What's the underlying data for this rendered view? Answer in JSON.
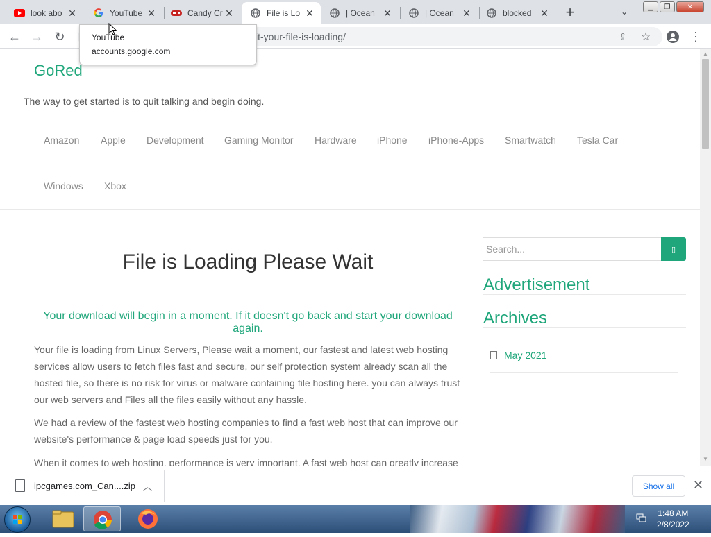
{
  "browser": {
    "tabs": [
      {
        "title": "look abo",
        "icon": "youtube-icon"
      },
      {
        "title": "YouTube",
        "icon": "google-icon"
      },
      {
        "title": "Candy Cr",
        "icon": "gamepad-icon"
      },
      {
        "title": "File is Lo",
        "icon": "globe-icon",
        "active": true
      },
      {
        "title": "| Ocean",
        "icon": "globe-icon"
      },
      {
        "title": "| Ocean",
        "icon": "globe-icon"
      },
      {
        "title": "blocked",
        "icon": "globe-icon"
      }
    ],
    "url": "it-your-file-is-loading/",
    "tooltip": {
      "title": "YouTube",
      "url": "accounts.google.com"
    }
  },
  "site": {
    "title": "GoRed",
    "tagline": "The way to get started is to quit talking and begin doing.",
    "nav": [
      "Amazon",
      "Apple",
      "Development",
      "Gaming Monitor",
      "Hardware",
      "iPhone",
      "iPhone-Apps",
      "Smartwatch",
      "Tesla Car",
      "Windows",
      "Xbox"
    ]
  },
  "post": {
    "title": "File is Loading Please Wait",
    "notice_line1": "Your download will begin in a moment. If it doesn't go back and start your download",
    "notice_line2": "again.",
    "paragraphs": [
      "Your file is loading from Linux Servers, Please wait a moment, our fastest and latest web hosting services allow users to fetch files fast and secure, our self protection system already scan all the hosted file, so there is no risk for virus or malware containing file hosting here. you can always trust our web servers and Files all the files easily without any hassle.",
      "We had a review of the fastest web hosting companies to find a fast web host that can improve our website's performance & page load speeds just for you.",
      "When it comes to web hosting, performance is very important. A fast web host can greatly increase"
    ]
  },
  "sidebar": {
    "search_placeholder": "Search...",
    "advertisement_title": "Advertisement",
    "archives_title": "Archives",
    "archives": [
      "May 2021"
    ]
  },
  "downloads": {
    "file_name": "ipcgames.com_Can....zip",
    "show_all": "Show all"
  },
  "taskbar": {
    "time": "1:48 AM",
    "date": "2/8/2022"
  },
  "colors": {
    "accent": "#1fa67a"
  }
}
